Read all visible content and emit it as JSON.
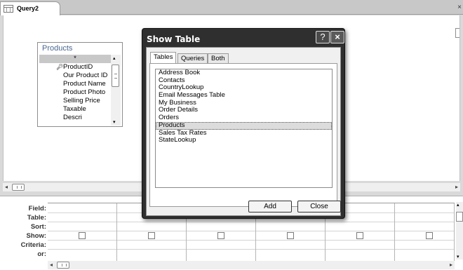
{
  "document_tab": {
    "title": "Query2",
    "icon": "query-icon",
    "close": "×"
  },
  "field_list": {
    "title": "Products",
    "items": [
      "*",
      "ProductID",
      "Our Product ID",
      "Product Name",
      "Product Photo",
      "Selling Price",
      "Taxable",
      "Descri"
    ],
    "primary_key_field": "ProductID"
  },
  "grid": {
    "row_labels": [
      "Field:",
      "Table:",
      "Sort:",
      "Show:",
      "Criteria:",
      "or:"
    ],
    "column_count": 6,
    "show_checked": [
      false,
      false,
      false,
      false,
      false,
      false
    ]
  },
  "dialog": {
    "title": "Show Table",
    "help_label": "?",
    "close_label": "×",
    "tabs": [
      "Tables",
      "Queries",
      "Both"
    ],
    "active_tab": "Tables",
    "tables": [
      "Address Book",
      "Contacts",
      "CountryLookup",
      "Email Messages Table",
      "My Business",
      "Order Details",
      "Orders",
      "Products",
      "Sales Tax Rates",
      "StateLookup"
    ],
    "selected_table": "Products",
    "add_label": "Add",
    "close_button_label": "Close"
  },
  "scroll": {
    "left_arrow": "◂",
    "right_arrow": "▸",
    "up_arrow": "▴",
    "down_arrow": "▾"
  },
  "colors": {
    "field_list_title": "#4a6791",
    "dialog_chrome": "#2f2f2f",
    "selection": "#dcdcdc"
  }
}
